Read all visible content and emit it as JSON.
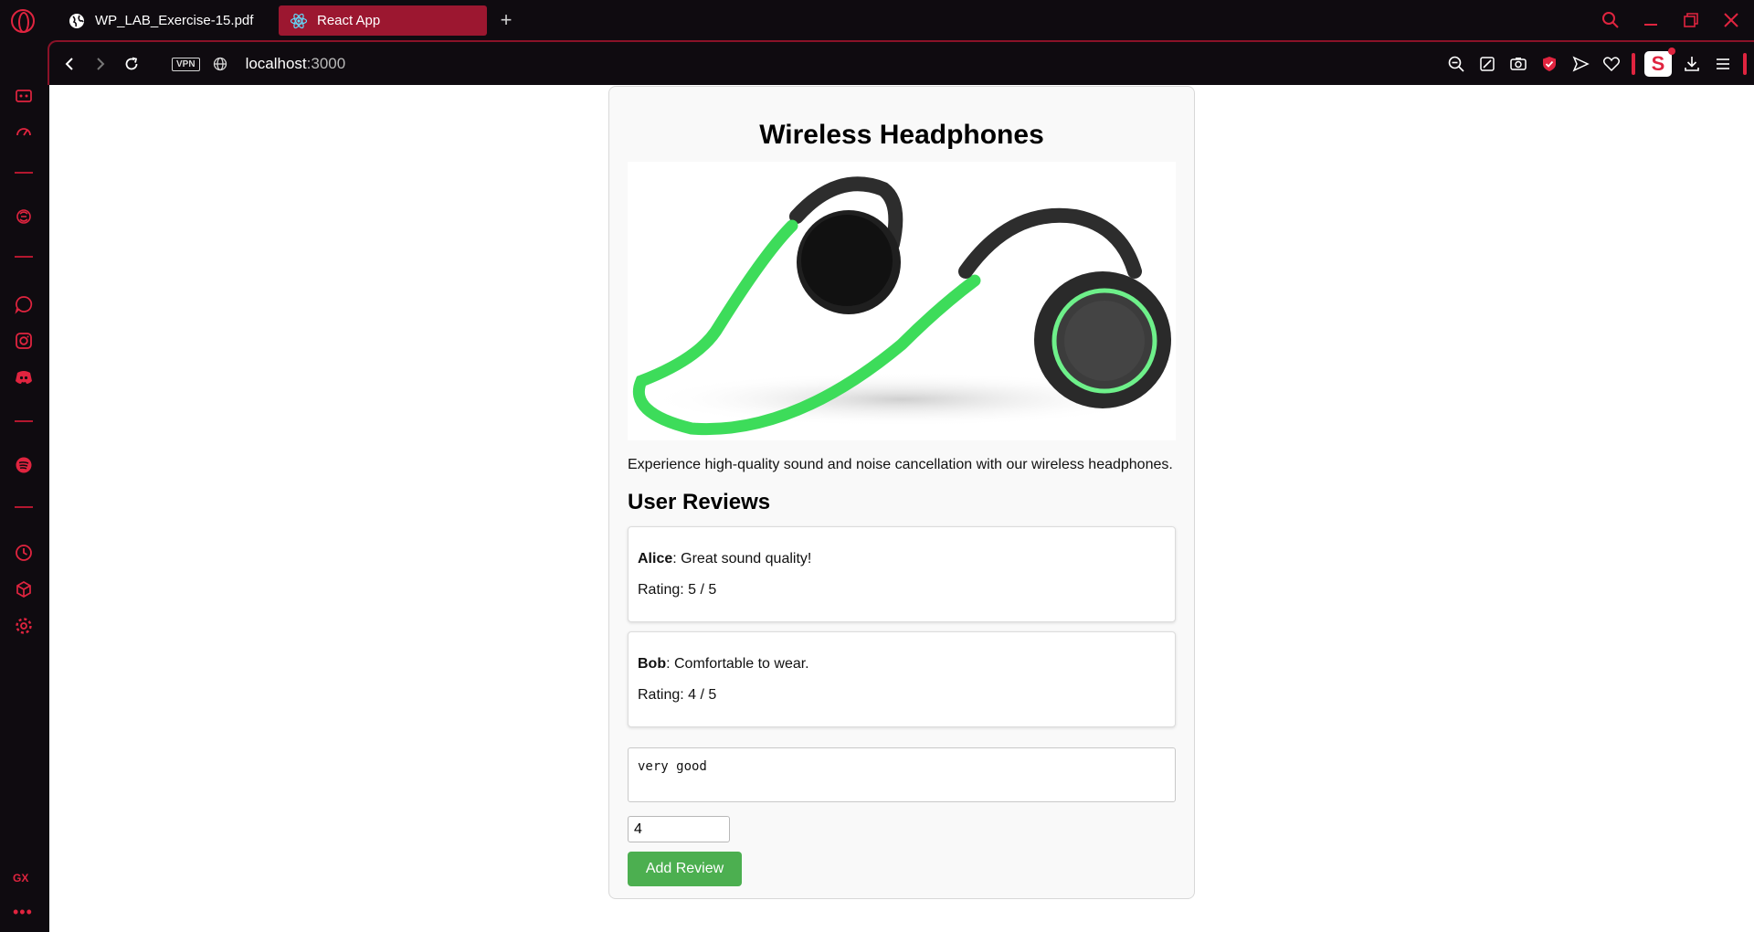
{
  "browser": {
    "tabs": [
      {
        "label": "WP_LAB_Exercise-15.pdf",
        "icon": "globe-icon",
        "active": false
      },
      {
        "label": "React App",
        "icon": "react-icon",
        "active": true
      }
    ],
    "vpn_label": "VPN",
    "url_host": "localhost",
    "url_port": ":3000",
    "sidebar_badge": "GX",
    "accent_color": "#e0243f"
  },
  "page": {
    "title": "Wireless Headphones",
    "description": "Experience high-quality sound and noise cancellation with our wireless headphones.",
    "reviews_heading": "User Reviews",
    "reviews": [
      {
        "user": "Alice",
        "comment": ": Great sound quality!",
        "rating_text": "Rating: 5 / 5"
      },
      {
        "user": "Bob",
        "comment": ": Comfortable to wear.",
        "rating_text": "Rating: 4 / 5"
      }
    ],
    "form": {
      "comment_value": "very good",
      "rating_value": "4",
      "submit_label": "Add Review"
    },
    "button_color": "#4caf50"
  }
}
